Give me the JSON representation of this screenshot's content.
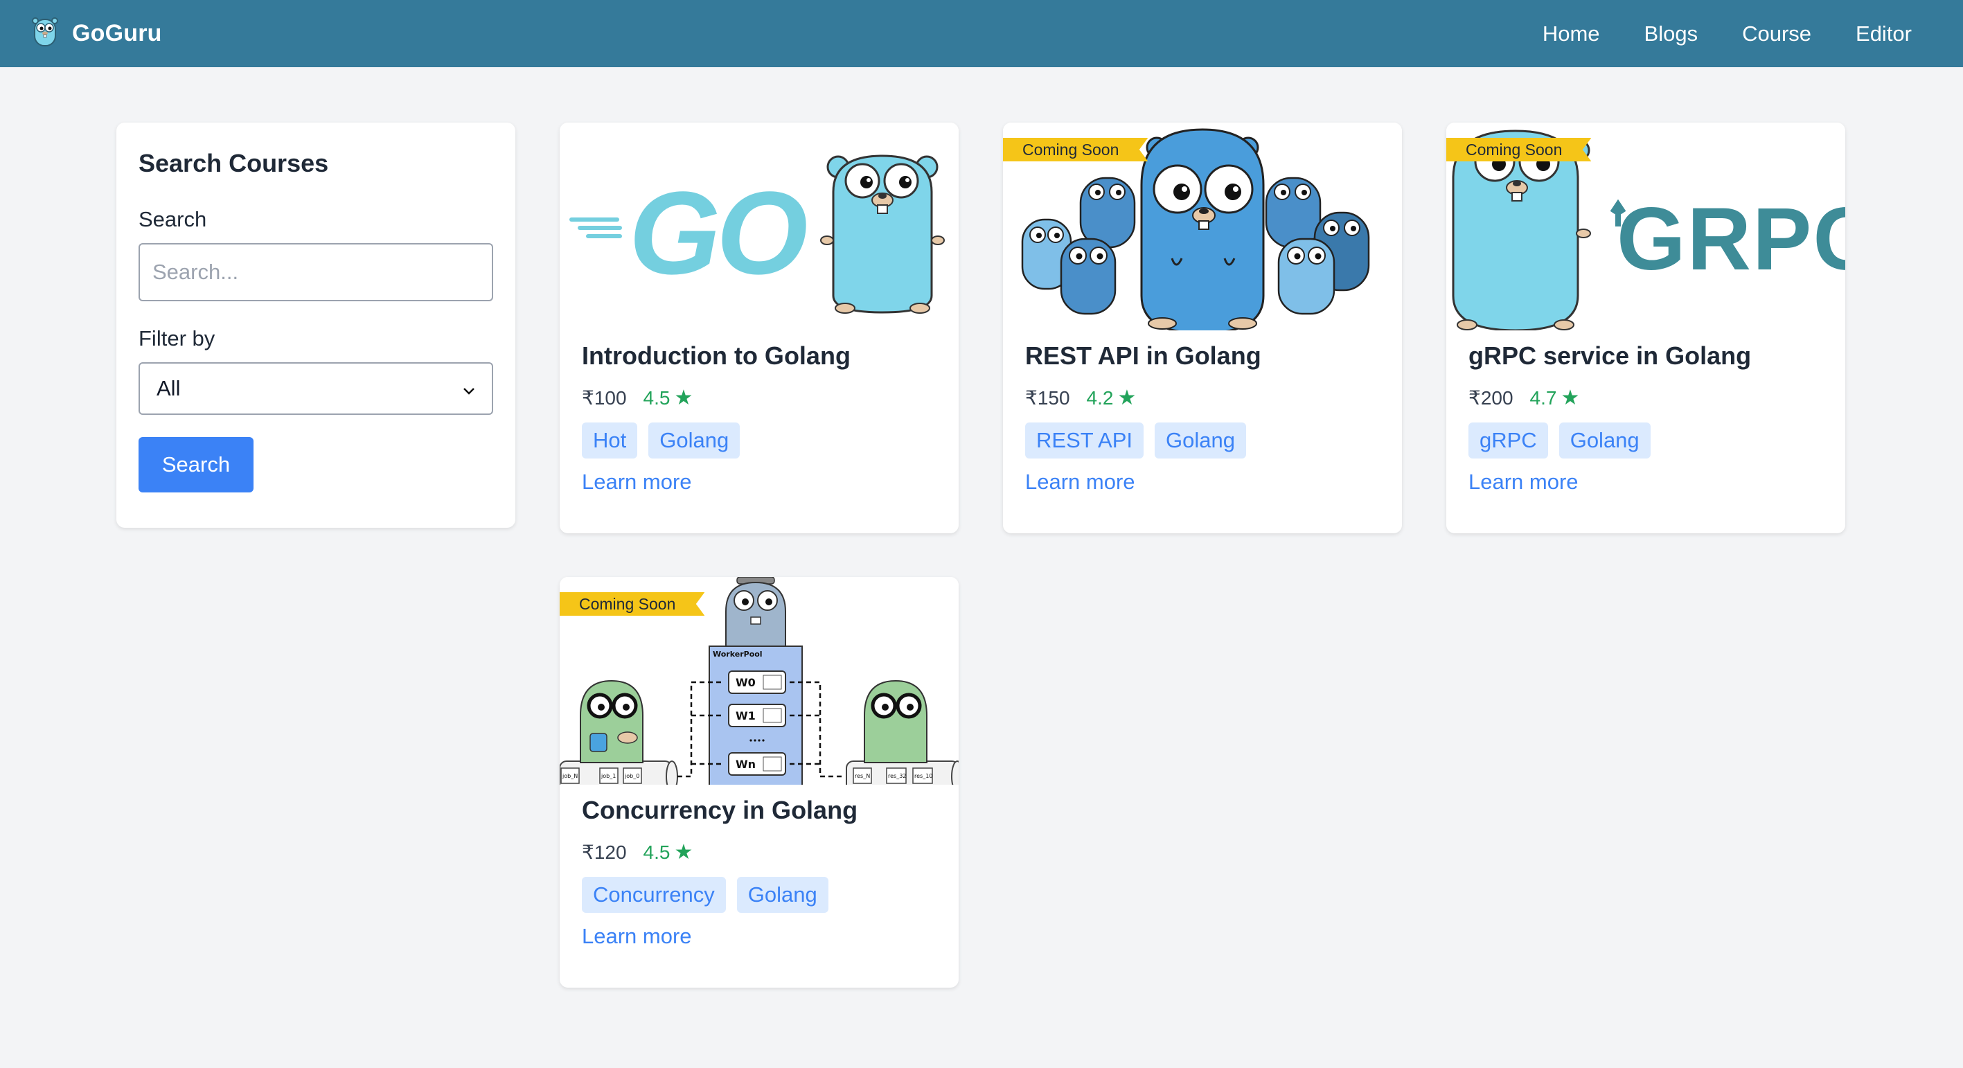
{
  "nav": {
    "brand": "GoGuru",
    "links": [
      "Home",
      "Blogs",
      "Course",
      "Editor"
    ]
  },
  "sidebar": {
    "title": "Search Courses",
    "search_label": "Search",
    "search_placeholder": "Search...",
    "search_value": "",
    "filter_label": "Filter by",
    "filter_value": "All",
    "search_button": "Search"
  },
  "courses": [
    {
      "title": "Introduction to Golang",
      "price": "₹100",
      "rating": "4.5",
      "tags": [
        "Hot",
        "Golang"
      ],
      "link": "Learn more",
      "ribbon": "",
      "image_icon": "go-logo-gopher-image"
    },
    {
      "title": "REST API in Golang",
      "price": "₹150",
      "rating": "4.2",
      "tags": [
        "REST API",
        "Golang"
      ],
      "link": "Learn more",
      "ribbon": "Coming Soon",
      "image_icon": "gopher-group-image"
    },
    {
      "title": "gRPC service in Golang",
      "price": "₹200",
      "rating": "4.7",
      "tags": [
        "gRPC",
        "Golang"
      ],
      "link": "Learn more",
      "ribbon": "Coming Soon",
      "image_icon": "gopher-grpc-image",
      "image_text": "GRPC"
    },
    {
      "title": "Concurrency in Golang",
      "price": "₹120",
      "rating": "4.5",
      "tags": [
        "Concurrency",
        "Golang"
      ],
      "link": "Learn more",
      "ribbon": "Coming Soon",
      "image_icon": "worker-pool-diagram-image",
      "image_text": {
        "pool": "WorkerPool",
        "workers": [
          "W0",
          "W1",
          "Wn"
        ],
        "jobs": [
          "job_N",
          "job_1",
          "job_0"
        ],
        "results": [
          "res_N",
          "res_32",
          "res_10"
        ]
      }
    }
  ],
  "colors": {
    "navbar": "#357a9a",
    "primary": "#3b82f6",
    "tag_bg": "#dbeafe",
    "rating": "#22a35a",
    "ribbon": "#f5c518"
  }
}
